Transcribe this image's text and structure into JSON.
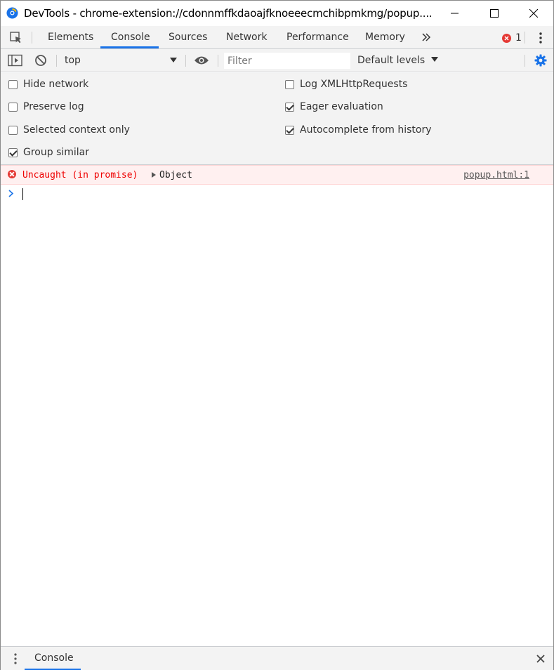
{
  "window": {
    "title": "DevTools - chrome-extension://cdonnmffkdaoajfknoeeecmchibpmkmg/popup...."
  },
  "tabs": [
    {
      "label": "Elements"
    },
    {
      "label": "Console"
    },
    {
      "label": "Sources"
    },
    {
      "label": "Network"
    },
    {
      "label": "Performance"
    },
    {
      "label": "Memory"
    }
  ],
  "error_badge": {
    "count": "1"
  },
  "toolbar": {
    "context": "top",
    "filter_placeholder": "Filter",
    "levels": "Default levels"
  },
  "settings": {
    "left": [
      {
        "label": "Hide network",
        "checked": false
      },
      {
        "label": "Preserve log",
        "checked": false
      },
      {
        "label": "Selected context only",
        "checked": false
      },
      {
        "label": "Group similar",
        "checked": true
      }
    ],
    "right": [
      {
        "label": "Log XMLHttpRequests",
        "checked": false
      },
      {
        "label": "Eager evaluation",
        "checked": true
      },
      {
        "label": "Autocomplete from history",
        "checked": true
      }
    ]
  },
  "console": {
    "error_message": "Uncaught (in promise)",
    "error_object": "Object",
    "error_source": "popup.html:1"
  },
  "drawer": {
    "tab_label": "Console"
  },
  "colors": {
    "accent": "#1a73e8",
    "error": "#e53935",
    "error_bg": "#fff0f0"
  }
}
